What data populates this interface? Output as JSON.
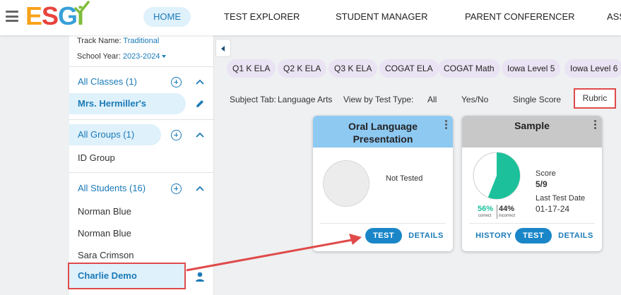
{
  "brand": {
    "logo_letters": [
      "E",
      "S",
      "G",
      "i"
    ]
  },
  "nav": {
    "items": [
      {
        "label": "HOME",
        "active": true
      },
      {
        "label": "TEST EXPLORER",
        "active": false
      },
      {
        "label": "STUDENT MANAGER",
        "active": false
      },
      {
        "label": "PARENT CONFERENCER",
        "active": false
      },
      {
        "label": "ASS",
        "active": false
      }
    ]
  },
  "sidebar": {
    "track_label": "Track Name:",
    "track_value": "Traditional",
    "year_label": "School Year:",
    "year_value": "2023-2024",
    "classes_header": "All Classes (1)",
    "class_name": "Mrs. Hermiller's",
    "groups_header": "All Groups (1)",
    "group_name": "ID Group",
    "students_header": "All Students (16)",
    "students": [
      "Norman Blue",
      "Norman Blue",
      "Sara Crimson"
    ],
    "selected_student": "Charlie Demo"
  },
  "tabs": [
    "Q1 K ELA",
    "Q2 K ELA",
    "Q3 K ELA",
    "COGAT ELA",
    "COGAT Math",
    "Iowa Level 5",
    "Iowa Level 6"
  ],
  "filters": {
    "subject_label": "Subject Tab:",
    "subject_value": "Language Arts",
    "view_label": "View by Test Type:",
    "options": [
      "All",
      "Yes/No",
      "Single Score",
      "Rubric"
    ],
    "selected": "Rubric"
  },
  "cards": [
    {
      "title_line1": "Oral Language",
      "title_line2": "Presentation",
      "status": "Not Tested",
      "buttons": [
        "TEST",
        "DETAILS"
      ],
      "header_color": "#8ec9f2"
    },
    {
      "title": "Sample",
      "correct_pct": "56%",
      "incorrect_pct": "44%",
      "correct_label": "correct",
      "incorrect_label": "incorrect",
      "score_label": "Score",
      "score_value": "5/9",
      "last_date_label": "Last Test Date",
      "last_date_value": "01-17-24",
      "buttons": [
        "HISTORY",
        "TEST",
        "DETAILS"
      ],
      "header_color": "#c8c8c8",
      "correct_fraction": 0.56,
      "correct_color": "#1cc19b"
    }
  ],
  "colors": {
    "accent": "#1a7ab8",
    "highlight": "#e04a4a"
  }
}
